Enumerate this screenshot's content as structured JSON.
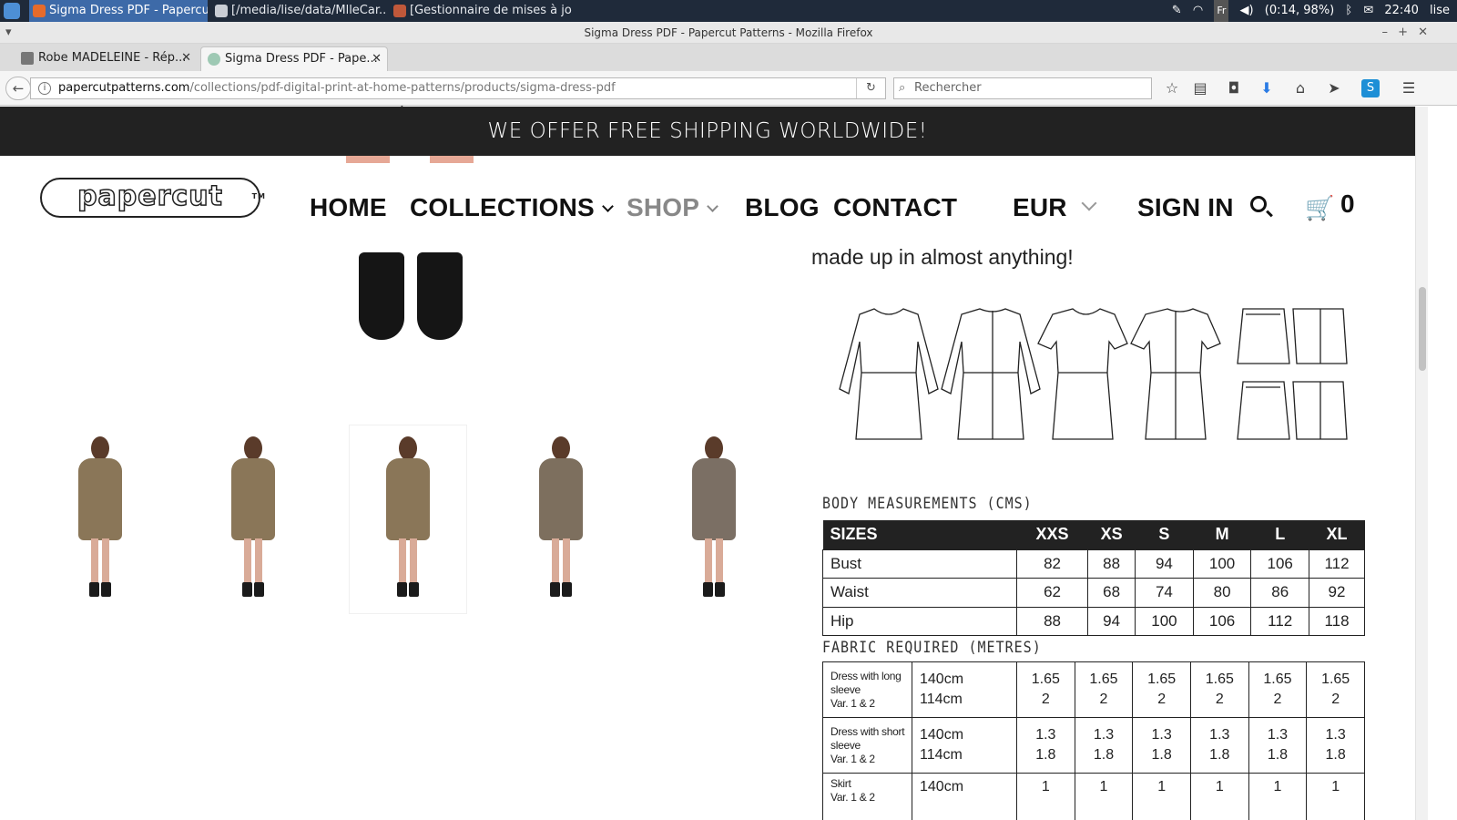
{
  "taskbar": {
    "tasks": [
      {
        "label": "Sigma Dress PDF - Papercu...",
        "active": true
      },
      {
        "label": "[/media/lise/data/MlleCar...",
        "active": false
      },
      {
        "label": "[Gestionnaire de mises à jo...",
        "active": false
      }
    ],
    "tray": {
      "keyboard": "Fr",
      "battery": "(0:14, 98%)",
      "clock": "22:40",
      "user": "lise"
    }
  },
  "window": {
    "title": "Sigma Dress PDF - Papercut Patterns - Mozilla Firefox"
  },
  "tabs": [
    {
      "label": "Robe MADELEINE - Rép..."
    },
    {
      "label": "Sigma Dress PDF - Pape..."
    }
  ],
  "navbar": {
    "url_domain": "papercutpatterns.com",
    "url_path": "/collections/pdf-digital-print-at-home-patterns/products/sigma-dress-pdf",
    "search_placeholder": "Rechercher"
  },
  "site": {
    "promo": "WE OFFER FREE SHIPPING WORLDWIDE!",
    "logo": "papercut",
    "logo_tm": "TM",
    "nav": {
      "home": "HOME",
      "collections": "COLLECTIONS",
      "shop": "SHOP",
      "blog": "BLOG",
      "contact": "CONTACT",
      "currency": "EUR",
      "signin": "SIGN IN",
      "cart_count": "0"
    }
  },
  "product": {
    "intro_tail": "made up in almost anything!",
    "thumbnails": [
      {
        "color": "#8a7658"
      },
      {
        "color": "#8a7658"
      },
      {
        "color": "#8a7658"
      },
      {
        "color": "#7d6f5e"
      },
      {
        "color": "#7b6f64"
      }
    ],
    "body_measurements_title": "BODY MEASUREMENTS (CMS)",
    "sizes_header": [
      "SIZES",
      "XXS",
      "XS",
      "S",
      "M",
      "L",
      "XL"
    ],
    "sizes_rows": [
      [
        "Bust",
        "82",
        "88",
        "94",
        "100",
        "106",
        "112"
      ],
      [
        "Waist",
        "62",
        "68",
        "74",
        "80",
        "86",
        "92"
      ],
      [
        "Hip",
        "88",
        "94",
        "100",
        "106",
        "112",
        "118"
      ]
    ],
    "fabric_title": "FABRIC REQUIRED (METRES)",
    "fabric_rows": [
      {
        "label": [
          "Dress with long",
          "sleeve",
          "Var. 1 & 2"
        ],
        "widths": [
          "140cm",
          "114cm"
        ],
        "values": [
          [
            "1.65",
            "2"
          ],
          [
            "1.65",
            "2"
          ],
          [
            "1.65",
            "2"
          ],
          [
            "1.65",
            "2"
          ],
          [
            "1.65",
            "2"
          ],
          [
            "1.65",
            "2"
          ]
        ]
      },
      {
        "label": [
          "Dress with short",
          "sleeve",
          "Var. 1 & 2"
        ],
        "widths": [
          "140cm",
          "114cm"
        ],
        "values": [
          [
            "1.3",
            "1.8"
          ],
          [
            "1.3",
            "1.8"
          ],
          [
            "1.3",
            "1.8"
          ],
          [
            "1.3",
            "1.8"
          ],
          [
            "1.3",
            "1.8"
          ],
          [
            "1.3",
            "1.8"
          ]
        ]
      },
      {
        "label": [
          "Skirt",
          "Var. 1 & 2"
        ],
        "widths": [
          "140cm",
          ""
        ],
        "values": [
          [
            "1",
            ""
          ],
          [
            "1",
            ""
          ],
          [
            "1",
            ""
          ],
          [
            "1",
            ""
          ],
          [
            "1",
            ""
          ],
          [
            "1",
            ""
          ]
        ]
      }
    ]
  }
}
